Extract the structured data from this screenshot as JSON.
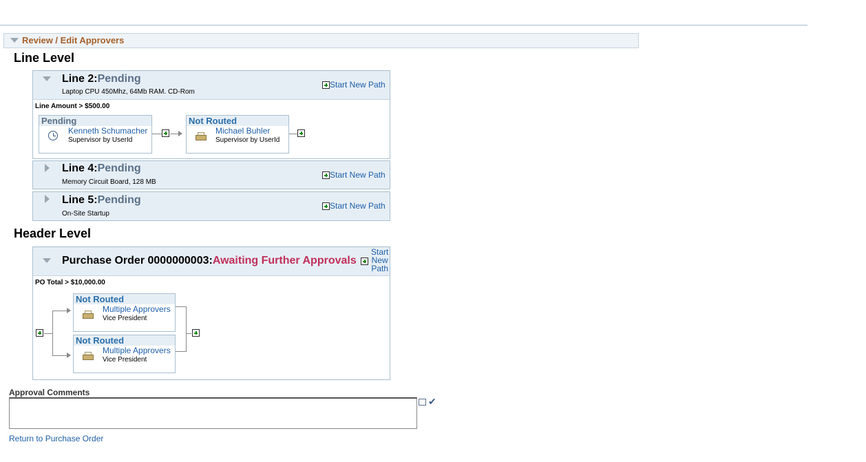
{
  "section": {
    "title": "Review / Edit Approvers"
  },
  "line_level": {
    "title": "Line Level",
    "lines": [
      {
        "label": "Line 2:",
        "status": "Pending",
        "description": "Laptop CPU 450Mhz, 64Mb RAM. CD-Rom",
        "start_path": "Start New Path",
        "criteria": "Line Amount > $500.00",
        "steps": [
          {
            "status": "Pending",
            "name": "Kenneth Schumacher",
            "role": "Supervisor by UserId",
            "icon": "clock-icon"
          },
          {
            "status": "Not Routed",
            "name": "Michael Buhler",
            "role": "Supervisor by UserId",
            "icon": "inbox-icon"
          }
        ]
      },
      {
        "label": "Line 4:",
        "status": "Pending",
        "description": "Memory Circuit Board, 128 MB",
        "start_path": "Start New Path"
      },
      {
        "label": "Line 5:",
        "status": "Pending",
        "description": "On-Site Startup",
        "start_path": "Start New Path"
      }
    ]
  },
  "header_level": {
    "title": "Header Level",
    "po": {
      "label": "Purchase Order 0000000003:",
      "status": "Awaiting Further Approvals",
      "start_path_1": "Start",
      "start_path_2": "New",
      "start_path_3": "Path",
      "criteria": "PO Total > $10,000.00",
      "steps": [
        {
          "status": "Not Routed",
          "name": "Multiple Approvers",
          "role": "Vice President",
          "icon": "inbox-icon"
        },
        {
          "status": "Not Routed",
          "name": "Multiple Approvers",
          "role": "Vice President",
          "icon": "inbox-icon"
        }
      ]
    }
  },
  "comments": {
    "label": "Approval Comments",
    "value": ""
  },
  "footer": {
    "return_link": "Return to Purchase Order"
  },
  "colors": {
    "accent": "#a6602a",
    "pending": "#5a7088",
    "awaiting": "#c0305a",
    "link": "#1f5fa8"
  }
}
